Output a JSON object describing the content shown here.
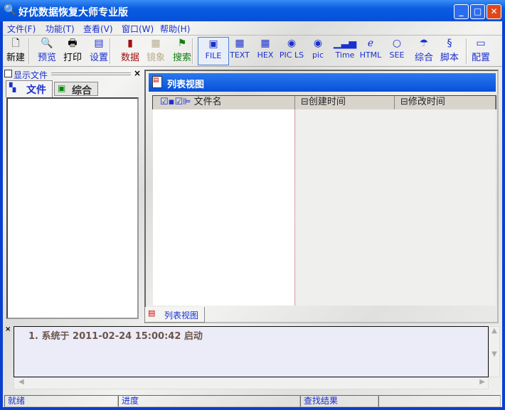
{
  "window": {
    "title": "好优数据恢复大师专业版",
    "minimize": "_",
    "maximize": "□",
    "close": "✕"
  },
  "menu": [
    "文件(F)",
    "功能(T)",
    "查看(V)",
    "窗口(W)",
    "帮助(H)"
  ],
  "toolbar": [
    {
      "label": "新建",
      "icon": "new-file-icon",
      "color": "#000000"
    },
    {
      "label": "预览",
      "icon": "preview-icon",
      "color": "#1a2fd0"
    },
    {
      "label": "打印",
      "icon": "printer-icon",
      "color": "#000000"
    },
    {
      "label": "设置",
      "icon": "settings-icon",
      "color": "#1a2fd0"
    },
    {
      "label": "数据",
      "icon": "data-chart-icon",
      "color": "#a01010"
    },
    {
      "label": "镜象",
      "icon": "mirror-icon",
      "color": "#b8ac8c"
    },
    {
      "label": "搜索",
      "icon": "search-icon",
      "color": "#108010"
    },
    {
      "label": "FILE",
      "icon": "file-icon",
      "color": "#1a2fd0"
    },
    {
      "label": "TEXT",
      "icon": "text-icon",
      "color": "#1a2fd0"
    },
    {
      "label": "HEX",
      "icon": "hex-icon",
      "color": "#1a2fd0"
    },
    {
      "label": "PIC LS",
      "icon": "disc-icon",
      "color": "#1a2fd0"
    },
    {
      "label": "pic",
      "icon": "disc-icon",
      "color": "#1a2fd0"
    },
    {
      "label": "Time",
      "icon": "time-chart-icon",
      "color": "#1a2fd0"
    },
    {
      "label": "HTML",
      "icon": "browser-icon",
      "color": "#1a2fd0"
    },
    {
      "label": "SEE",
      "icon": "magnifier-icon",
      "color": "#1a2fd0"
    },
    {
      "label": "综合",
      "icon": "umbrella-icon",
      "color": "#1a2fd0"
    },
    {
      "label": "脚本",
      "icon": "script-icon",
      "color": "#1a2fd0"
    },
    {
      "label": "配置",
      "icon": "config-icon",
      "color": "#1a2fd0"
    }
  ],
  "left_panel": {
    "title": "显示文件",
    "close": "×",
    "tabs": [
      "文件",
      "综合"
    ]
  },
  "list_view": {
    "title": "列表视图",
    "columns": [
      "文件名",
      "创建时间",
      "修改时间"
    ],
    "tab": "列表视图"
  },
  "log": {
    "close": "×",
    "entries": [
      "1. 系统于 2011-02-24 15:00:42 启动"
    ]
  },
  "status": [
    "就绪",
    "进度",
    "查找结果",
    ""
  ]
}
